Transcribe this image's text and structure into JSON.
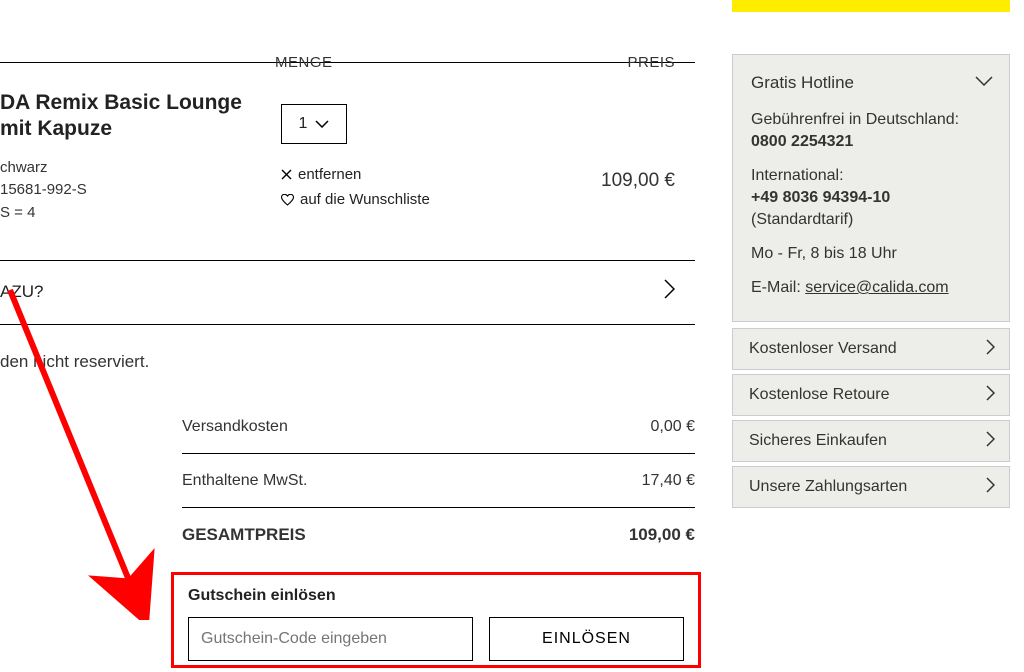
{
  "headers": {
    "qty": "MENGE",
    "price": "PREIS"
  },
  "product": {
    "title_line1": "DA Remix Basic Lounge",
    "title_line2": "mit Kapuze",
    "color": "chwarz",
    "sku": "15681-992-S",
    "size_line": "S = 4",
    "qty_value": "1",
    "remove": "entfernen",
    "wishlist": "auf die Wunschliste",
    "price": "109,00 €"
  },
  "suggestion": {
    "label": "AZU?"
  },
  "note": "den nicht reserviert.",
  "summary": {
    "shipping_label": "Versandkosten",
    "shipping_value": "0,00 €",
    "tax_label": "Enthaltene MwSt.",
    "tax_value": "17,40 €",
    "total_label": "GESAMTPREIS",
    "total_value": "109,00 €"
  },
  "coupon": {
    "title": "Gutschein einlösen",
    "placeholder": "Gutschein-Code eingeben",
    "button": "EINLÖSEN"
  },
  "hotline": {
    "title": "Gratis Hotline",
    "de_label": "Gebührenfrei in Deutschland:",
    "de_phone": "0800 2254321",
    "intl_label": "International:",
    "intl_phone": "+49 8036 94394-10",
    "intl_note": "(Standardtarif)",
    "hours": "Mo - Fr, 8 bis 18 Uhr",
    "email_label": "E-Mail: ",
    "email": "service@calida.com"
  },
  "side_links": [
    "Kostenloser Versand",
    "Kostenlose Retoure",
    "Sicheres Einkaufen",
    "Unsere Zahlungsarten"
  ]
}
